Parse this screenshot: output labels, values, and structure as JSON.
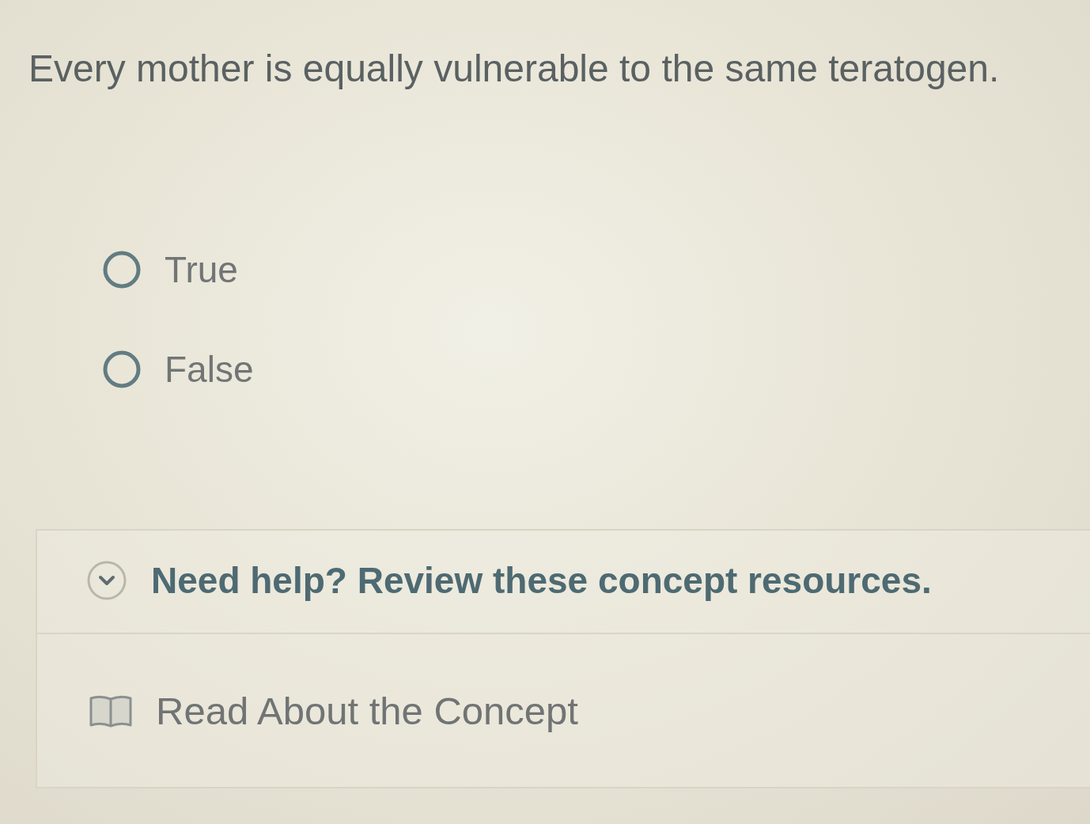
{
  "question": {
    "text": "Every mother is equally vulnerable to the same teratogen."
  },
  "options": [
    {
      "label": "True",
      "selected": false
    },
    {
      "label": "False",
      "selected": false
    }
  ],
  "help": {
    "title": "Need help? Review these concept resources.",
    "expanded": true,
    "resources": [
      {
        "kind": "reading",
        "label": "Read About the Concept"
      }
    ]
  }
}
